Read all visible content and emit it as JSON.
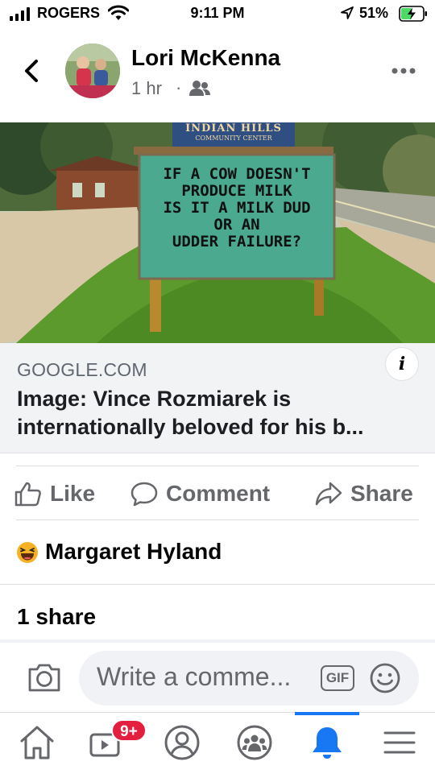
{
  "status_bar": {
    "carrier": "ROGERS",
    "time": "9:11 PM",
    "battery_percent": "51%",
    "battery_level": 0.51,
    "icons": [
      "signal-icon",
      "wifi-icon",
      "location-arrow-icon",
      "battery-charging-icon"
    ]
  },
  "post": {
    "author": "Lori McKenna",
    "time": "1 hr",
    "separator": "·",
    "audience_icon": "friends-icon",
    "photo_sign": {
      "header": "INDIAN HILLS",
      "subheader": "COMMUNITY CENTER",
      "lines": [
        "IF A COW DOESN'T",
        "PRODUCE MILK",
        "IS IT A MILK DUD",
        "OR AN",
        "UDDER FAILURE?"
      ]
    },
    "link": {
      "domain": "GOOGLE.COM",
      "title": "Image: Vince Rozmiarek is internationally beloved for his b...",
      "info_label": "i"
    }
  },
  "actions": {
    "like": "Like",
    "comment": "Comment",
    "share": "Share"
  },
  "reactions": {
    "emoji": "haha-emoji",
    "name": "Margaret Hyland"
  },
  "shares": "1 share",
  "composer": {
    "placeholder": "Write a comme...",
    "gif_label": "GIF"
  },
  "tabbar": {
    "tabs": [
      "home-icon",
      "watch-icon",
      "profile-icon",
      "groups-icon",
      "notifications-icon",
      "menu-icon"
    ],
    "active": "notifications-icon",
    "watch_badge": "9+"
  },
  "colors": {
    "accent": "#1877f2",
    "badge": "#e41e3f",
    "secondary_text": "#65676b",
    "sign_green": "#4aa98e"
  }
}
